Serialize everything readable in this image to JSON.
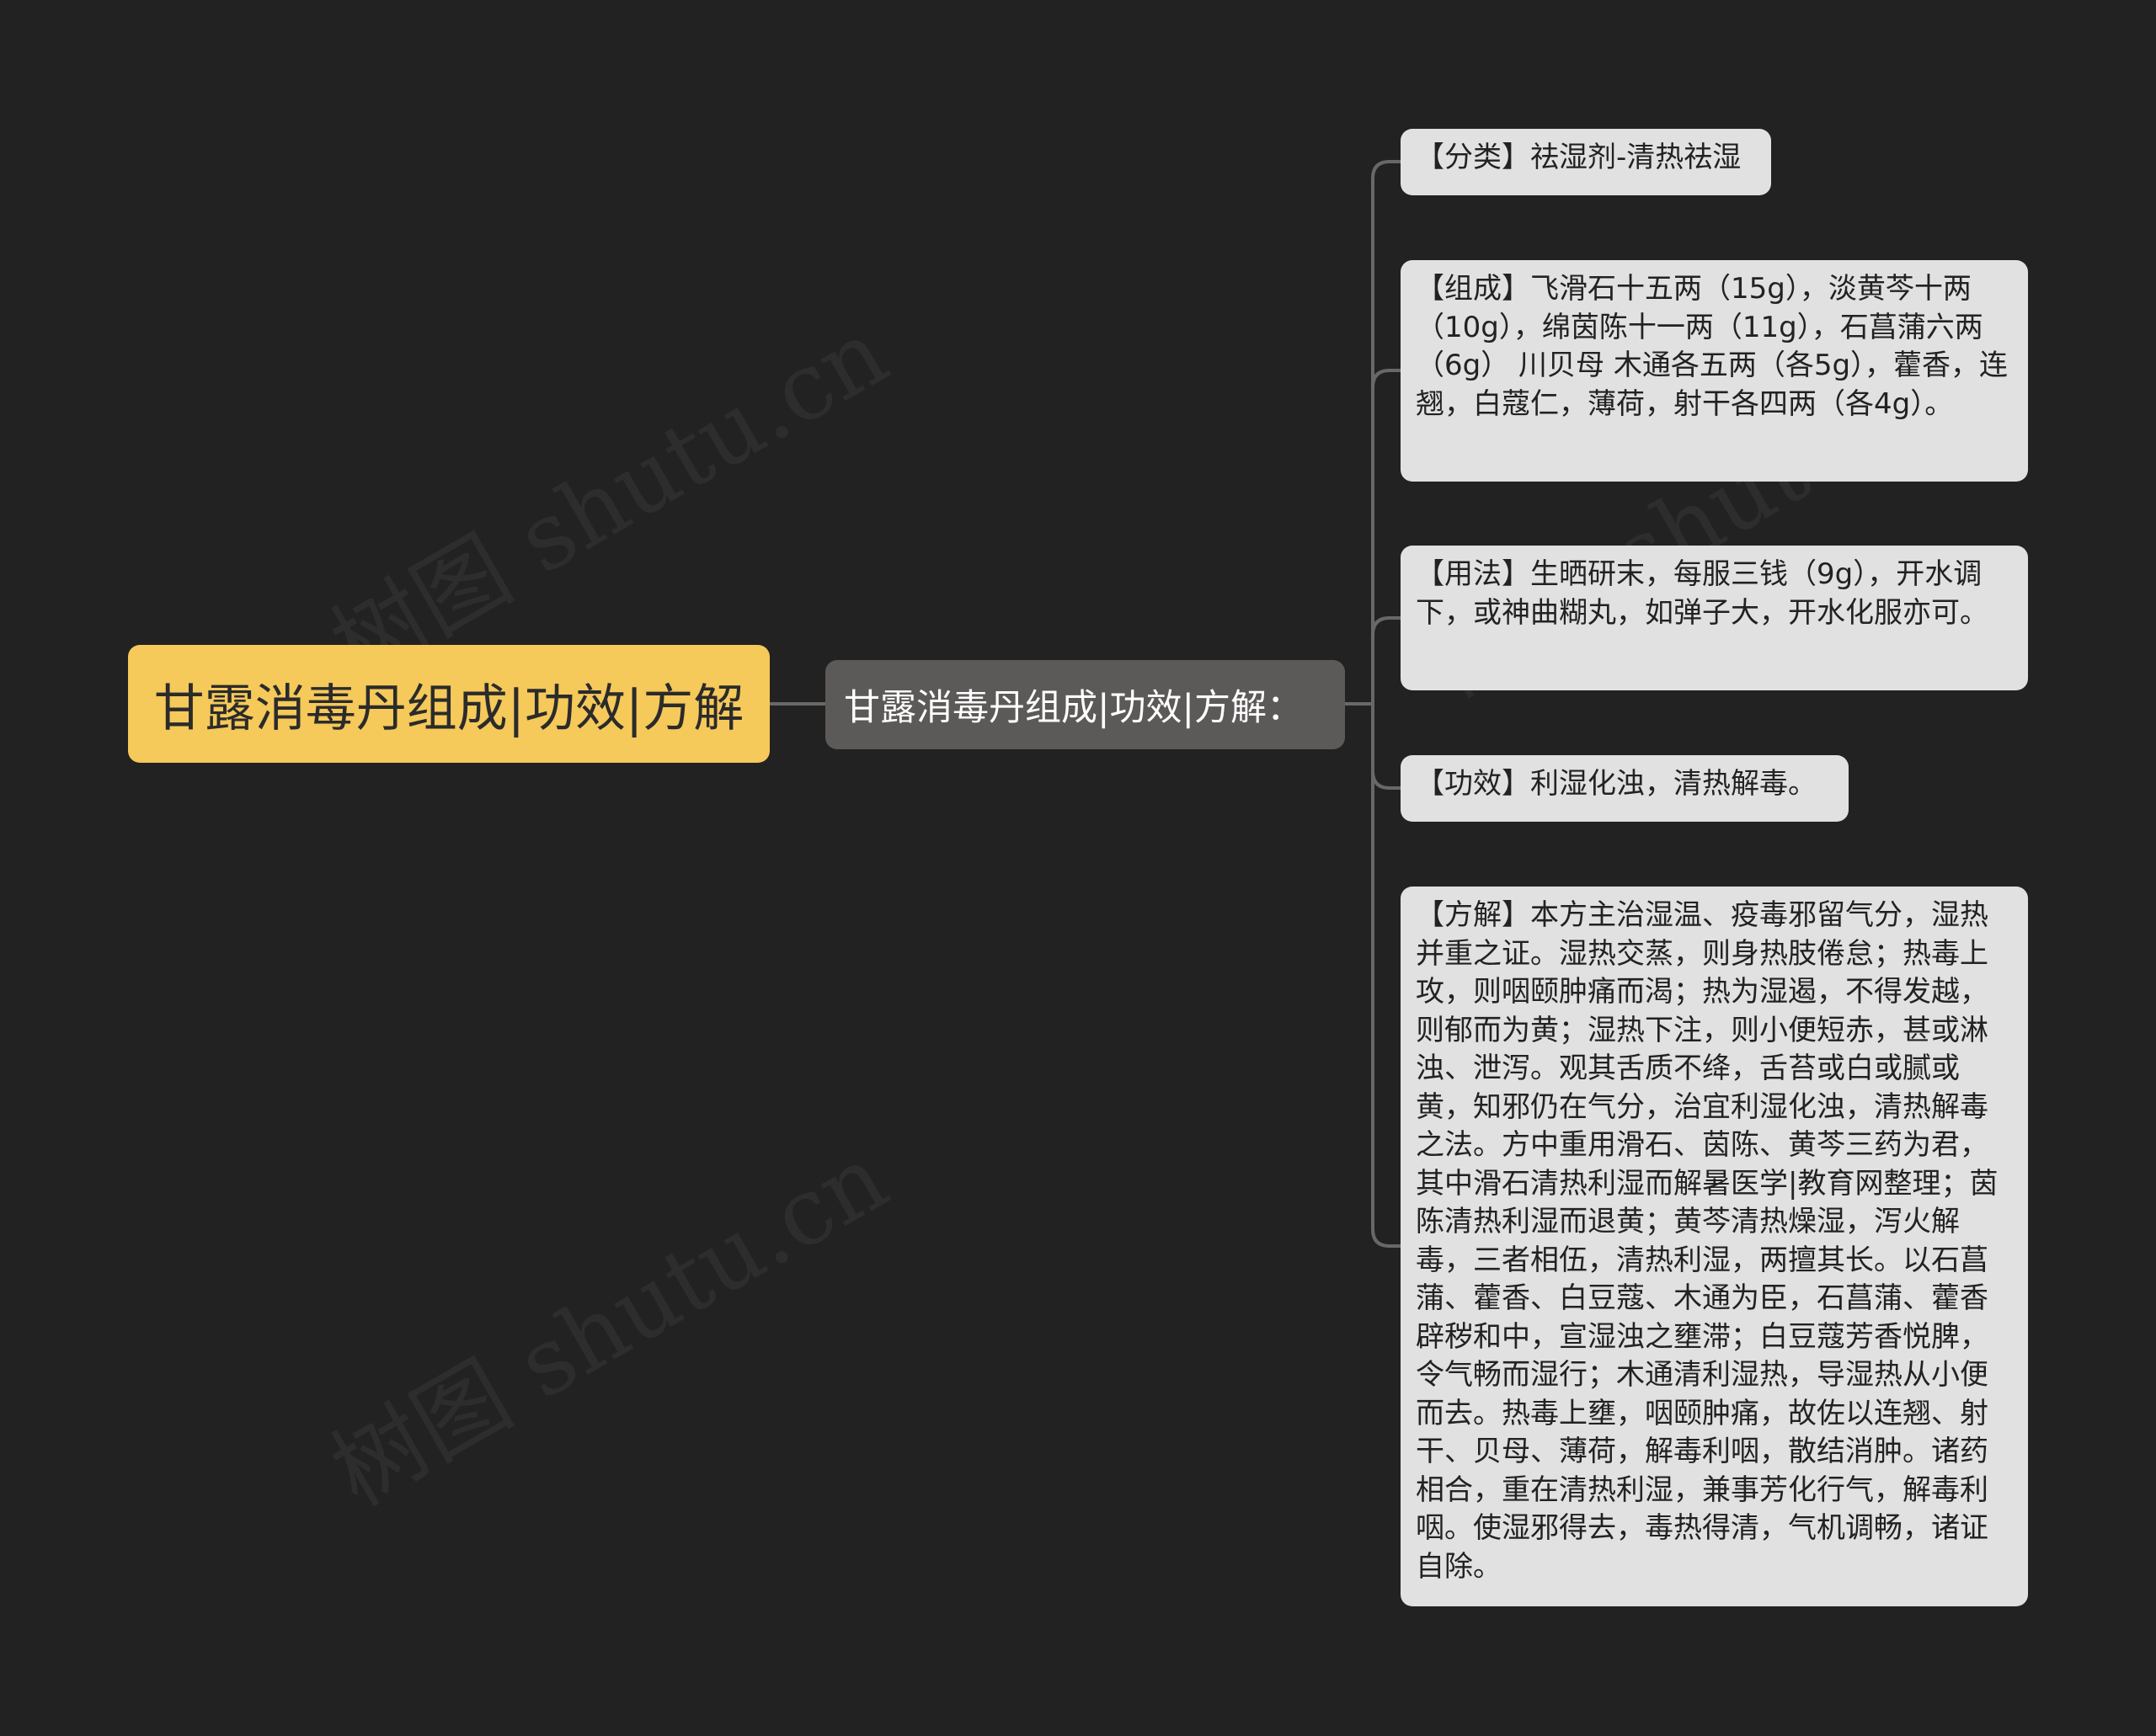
{
  "colors": {
    "background": "#222222",
    "root_fill": "#f5c95a",
    "hub_fill": "#5c5a58",
    "leaf_fill": "#e1e1e1",
    "connector": "#6a6866"
  },
  "watermark": "树图 shutu.cn",
  "root": {
    "text": "甘露消毒丹组成|功效|方解"
  },
  "hub": {
    "text": "甘露消毒丹组成|功效|方解："
  },
  "leaves": [
    {
      "text": "【分类】祛湿剂-清热祛湿"
    },
    {
      "text": "【组成】飞滑石十五两（15g），淡黄芩十两（10g），绵茵陈十一两（11g），石菖蒲六两（6g） 川贝母 木通各五两（各5g），藿香，连翘，白蔻仁，薄荷，射干各四两（各4g）。"
    },
    {
      "text": "【用法】生晒研末，每服三钱（9g），开水调下，或神曲糊丸，如弹子大，开水化服亦可。"
    },
    {
      "text": "【功效】利湿化浊，清热解毒。"
    },
    {
      "text": "【方解】本方主治湿温、疫毒邪留气分，湿热并重之证。湿热交蒸，则身热肢倦怠；热毒上攻，则咽颐肿痛而渴；热为湿遏，不得发越，则郁而为黄；湿热下注，则小便短赤，甚或淋浊、泄泻。观其舌质不绛，舌苔或白或腻或黄，知邪仍在气分，治宜利湿化浊，清热解毒之法。方中重用滑石、茵陈、黄芩三药为君，其中滑石清热利湿而解暑医学|教育网整理；茵陈清热利湿而退黄；黄芩清热燥湿，泻火解毒，三者相伍，清热利湿，两擅其长。以石菖蒲、藿香、白豆蔻、木通为臣，石菖蒲、藿香辟秽和中，宣湿浊之壅滞；白豆蔻芳香悦脾，令气畅而湿行；木通清利湿热，导湿热从小便而去。热毒上壅，咽颐肿痛，故佐以连翘、射干、贝母、薄荷，解毒利咽，散结消肿。诸药相合，重在清热利湿，兼事芳化行气，解毒利咽。使湿邪得去，毒热得清，气机调畅，诸证自除。"
    }
  ]
}
